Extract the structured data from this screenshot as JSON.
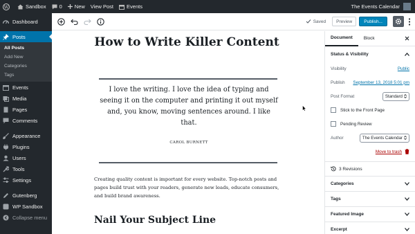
{
  "admin_bar": {
    "site": "Sandbox",
    "comments_count": "0",
    "new_label": "New",
    "view_post": "View Post",
    "events": "Events",
    "right_label": "The Events Calendar"
  },
  "sidebar": {
    "items": [
      {
        "label": "Dashboard"
      },
      {
        "label": "Posts"
      },
      {
        "label": "Events"
      },
      {
        "label": "Media"
      },
      {
        "label": "Pages"
      },
      {
        "label": "Comments"
      },
      {
        "label": "Appearance"
      },
      {
        "label": "Plugins"
      },
      {
        "label": "Users"
      },
      {
        "label": "Tools"
      },
      {
        "label": "Settings"
      },
      {
        "label": "Gutenberg"
      },
      {
        "label": "WP Sandbox"
      },
      {
        "label": "Collapse menu"
      }
    ],
    "posts_sub": [
      "All Posts",
      "Add New",
      "Categories",
      "Tags"
    ]
  },
  "toolbar": {
    "saved": "Saved",
    "preview": "Preview",
    "publish": "Publish..."
  },
  "content": {
    "title": "How to Write Killer Content",
    "quote": "I love the writing. I love the idea of typing and seeing it on the computer and printing it out myself and, you know, moving sentences around. I like that.",
    "citation": "CAROL BURNETT",
    "paragraph": "Creating quality content is important for every website.  Top-notch posts and pages build trust with your readers, generate new leads, educate consumers, and build brand awareness.",
    "heading": "Nail Your Subject Line"
  },
  "panel": {
    "tab_document": "Document",
    "tab_block": "Block",
    "status_heading": "Status & Visibility",
    "visibility_label": "Visibility",
    "visibility_value": "Public",
    "publish_label": "Publish",
    "publish_value": "September 13, 2018 5:01 pm",
    "format_label": "Post Format",
    "format_value": "Standard",
    "sticky_label": "Stick to the Front Page",
    "pending_label": "Pending Review",
    "author_label": "Author",
    "author_value": "The Events Calendar",
    "trash_label": "Move to trash",
    "revisions": "3 Revisions",
    "sections": [
      "Categories",
      "Tags",
      "Featured Image",
      "Excerpt"
    ]
  },
  "colors": {
    "admin_dark": "#23282d",
    "accent_blue": "#0073aa",
    "publish_blue": "#0085ba",
    "trash_red": "#a00"
  }
}
